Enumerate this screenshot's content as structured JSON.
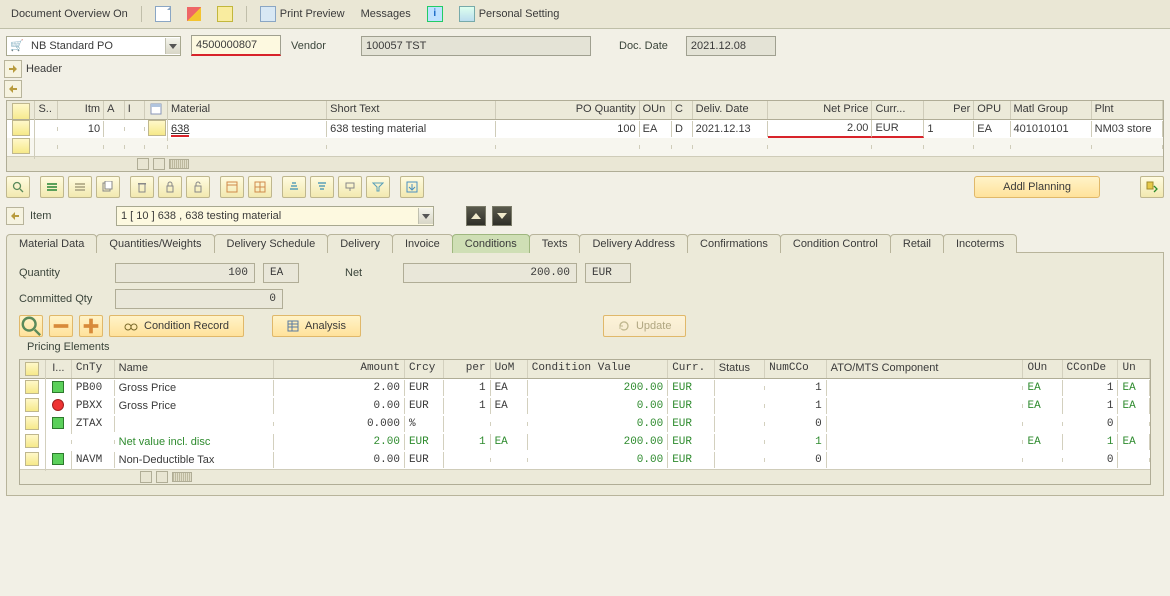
{
  "toolbar": {
    "doc_overview": "Document Overview On",
    "print_preview": "Print Preview",
    "messages": "Messages",
    "personal_setting": "Personal Setting",
    "info_icon_text": "i"
  },
  "header": {
    "po_type": "NB Standard PO",
    "po_number": "4500000807",
    "vendor_label": "Vendor",
    "vendor": "100057 TST",
    "doc_date_label": "Doc. Date",
    "doc_date": "2021.12.08",
    "header_label": "Header"
  },
  "item_grid": {
    "cols": {
      "s": "S..",
      "itm": "Itm",
      "a": "A",
      "i": "I",
      "material": "Material",
      "short_text": "Short Text",
      "po_qty": "PO Quantity",
      "oun": "OUn",
      "c": "C",
      "dd": "Deliv. Date",
      "np": "Net Price",
      "curr": "Curr...",
      "per": "Per",
      "opu": "OPU",
      "matl_group": "Matl Group",
      "plant": "Plnt"
    },
    "rows": [
      {
        "itm": "10",
        "material": "638",
        "short_text": "638 testing material",
        "qty": "100",
        "oun": "EA",
        "c": "D",
        "dd": "2021.12.13",
        "np": "2.00",
        "curr": "EUR",
        "per": "1",
        "opu": "EA",
        "mg": "401010101",
        "plant": "NM03 store"
      }
    ]
  },
  "item_section": {
    "label": "Item",
    "dropdown": "1 [ 10 ] 638 , 638 testing material"
  },
  "addl_planning": "Addl Planning",
  "tabs": [
    "Material Data",
    "Quantities/Weights",
    "Delivery Schedule",
    "Delivery",
    "Invoice",
    "Conditions",
    "Texts",
    "Delivery Address",
    "Confirmations",
    "Condition Control",
    "Retail",
    "Incoterms"
  ],
  "active_tab_index": 5,
  "cond": {
    "qty_label": "Quantity",
    "qty_val": "100",
    "qty_unit": "EA",
    "net_label": "Net",
    "net_val": "200.00",
    "net_unit": "EUR",
    "committed_label": "Committed Qty",
    "committed_val": "0",
    "cond_record_btn": "Condition Record",
    "analysis_btn": "Analysis",
    "update_btn": "Update",
    "group_title": "Pricing Elements"
  },
  "pricing": {
    "cols": {
      "i": "I...",
      "cnty": "CnTy",
      "name": "Name",
      "amt": "Amount",
      "crcy": "Crcy",
      "per": "per",
      "uom": "UoM",
      "cv": "Condition Value",
      "curr": "Curr.",
      "status": "Status",
      "numc": "NumCCo",
      "ato": "ATO/MTS Component",
      "oun": "OUn",
      "cconde": "CConDe",
      "un": "Un"
    },
    "rows": [
      {
        "status": "green",
        "cnty": "PB00",
        "name": "Gross Price",
        "amt": "2.00",
        "crcy": "EUR",
        "per": "1",
        "uom": "EA",
        "cv": "200.00",
        "curr": "EUR",
        "numc": "1",
        "oun": "EA",
        "cconde": "1",
        "un": "EA"
      },
      {
        "status": "red",
        "cnty": "PBXX",
        "name": "Gross Price",
        "amt": "0.00",
        "crcy": "EUR",
        "per": "1",
        "uom": "EA",
        "cv": "0.00",
        "curr": "EUR",
        "numc": "1",
        "oun": "EA",
        "cconde": "1",
        "un": "EA"
      },
      {
        "status": "green",
        "cnty": "ZTAX",
        "name": "",
        "amt": "0.000",
        "crcy": "%",
        "per": "",
        "uom": "",
        "cv": "0.00",
        "curr": "EUR",
        "numc": "0",
        "oun": "",
        "cconde": "0",
        "un": ""
      },
      {
        "netrow": true,
        "cnty": "",
        "name": "Net value incl. disc",
        "amt": "2.00",
        "crcy": "EUR",
        "per": "1",
        "uom": "EA",
        "cv": "200.00",
        "curr": "EUR",
        "numc": "1",
        "oun": "EA",
        "cconde": "1",
        "un": "EA"
      },
      {
        "status": "green",
        "cnty": "NAVM",
        "name": "Non-Deductible Tax",
        "amt": "0.00",
        "crcy": "EUR",
        "per": "",
        "uom": "",
        "cv": "0.00",
        "curr": "EUR",
        "numc": "0",
        "oun": "",
        "cconde": "0",
        "un": ""
      }
    ]
  }
}
